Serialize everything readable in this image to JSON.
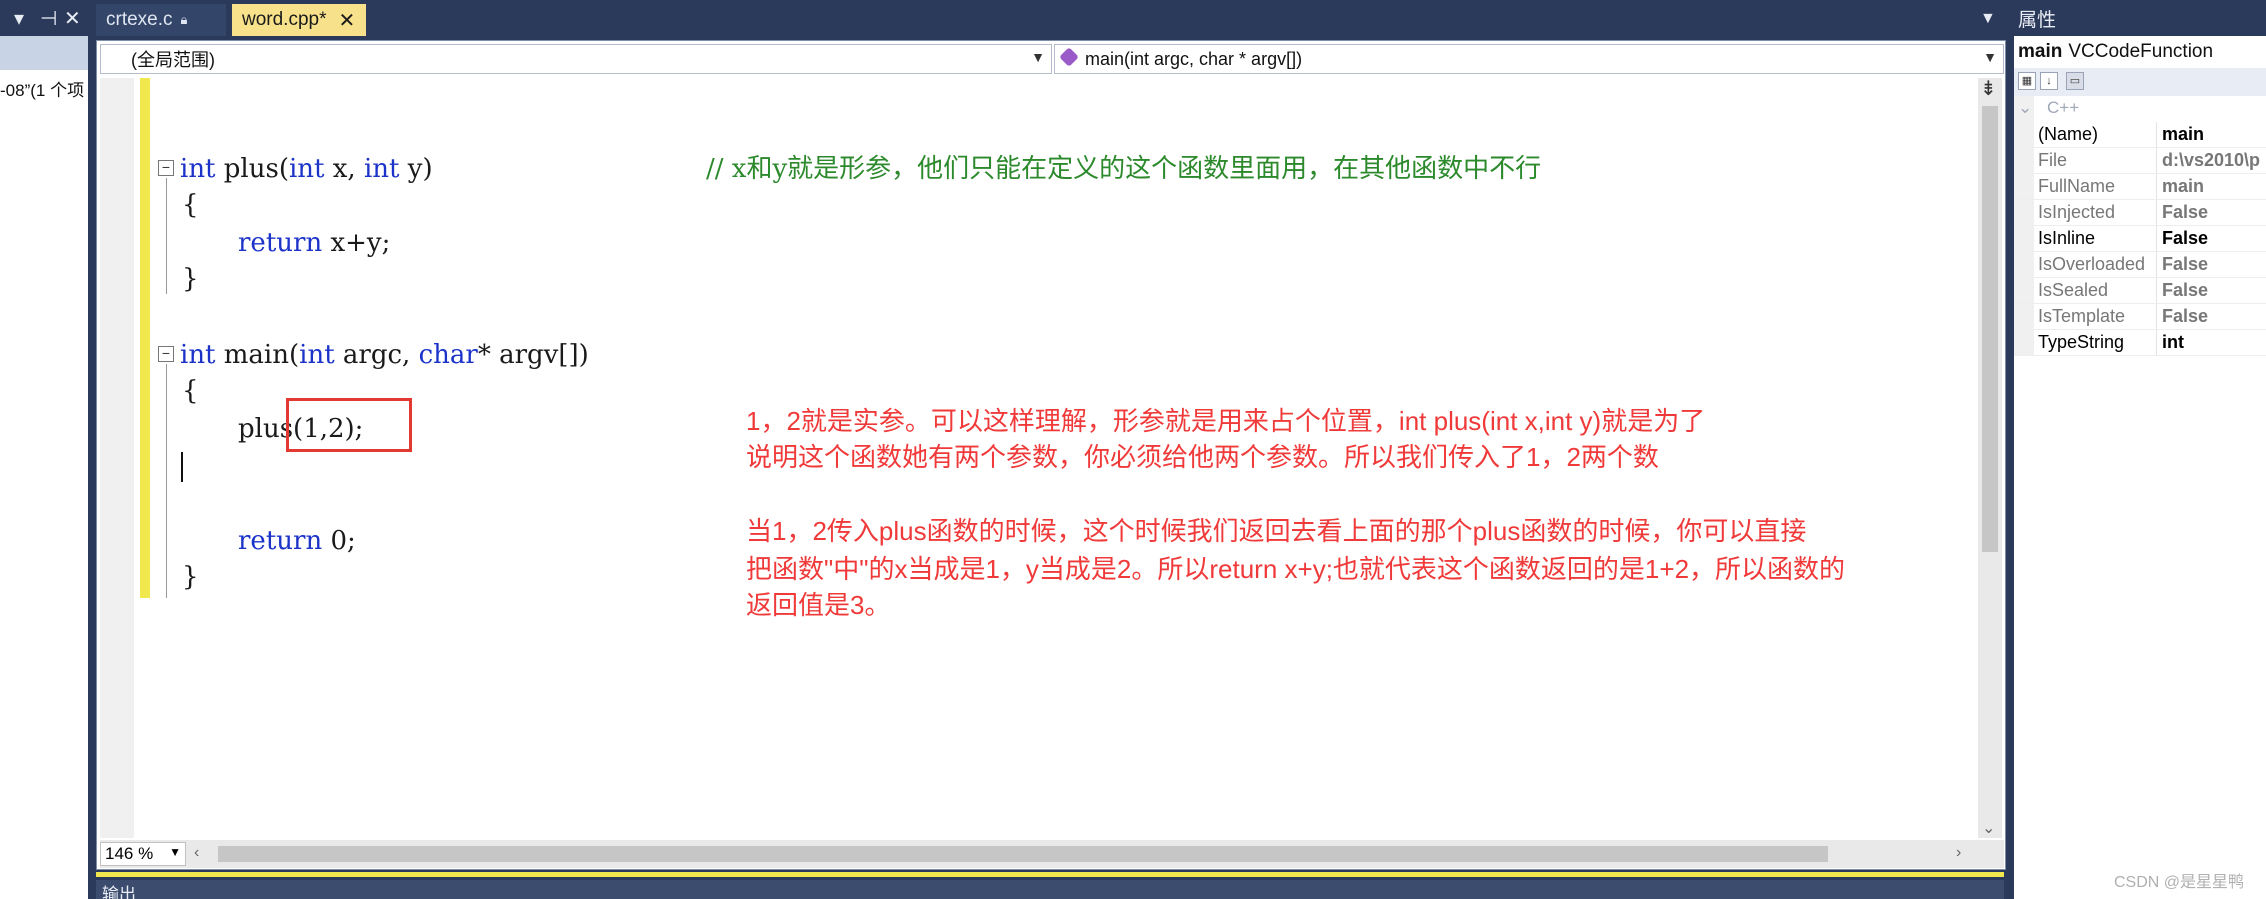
{
  "left_panel": {
    "controls": [
      "▾",
      "⊣",
      "✕"
    ],
    "truncated_text": "-08”(1 个项"
  },
  "tabs": [
    {
      "label": "crtexe.c",
      "icon": "lock-icon"
    },
    {
      "label": "word.cpp*",
      "close": "✕"
    }
  ],
  "toolbar": {
    "scope": "(全局范围)",
    "function": "main(int argc, char * argv[])"
  },
  "code": {
    "l1_kw1": "int",
    "l1_mid1": " plus(",
    "l1_kw2": "int",
    "l1_mid2": " x, ",
    "l1_kw3": "int",
    "l1_end": " y)",
    "l1_comment": "// x和y就是形参，他们只能在定义的这个函数里面用，在其他函数中不行",
    "l2": "{",
    "l3_kw": "return",
    "l3_rest": " x+y;",
    "l4": "}",
    "l5_kw1": "int",
    "l5_mid1": " main(",
    "l5_kw2": "int",
    "l5_mid2": " argc, ",
    "l5_kw3": "char",
    "l5_end": "* argv[])",
    "l6": "{",
    "l7": "plus(1,2);",
    "l8_kw": "return",
    "l8_rest": " 0;",
    "l9": "}"
  },
  "annotations": [
    "1，2就是实参。可以这样理解，形参就是用来占个位置，int plus(int x,int y)就是为了",
    "说明这个函数她有两个参数，你必须给他两个参数。所以我们传入了1，2两个数",
    "当1，2传入plus函数的时候，这个时候我们返回去看上面的那个plus函数的时候，你可以直接",
    "把函数\"中\"的x当成是1，y当成是2。所以return x+y;也就代表这个函数返回的是1+2，所以函数的",
    "返回值是3。"
  ],
  "status": {
    "zoom": "146 %"
  },
  "output_panel": {
    "title": "输出"
  },
  "properties": {
    "title": "属性",
    "object_name": "main",
    "object_type": "VCCodeFunction",
    "category": "C++",
    "rows": [
      {
        "name": "(Name)",
        "value": "main"
      },
      {
        "name": "File",
        "value": "d:\\vs2010\\p"
      },
      {
        "name": "FullName",
        "value": "main"
      },
      {
        "name": "IsInjected",
        "value": "False"
      },
      {
        "name": "IsInline",
        "value": "False"
      },
      {
        "name": "IsOverloaded",
        "value": "False"
      },
      {
        "name": "IsSealed",
        "value": "False"
      },
      {
        "name": "IsTemplate",
        "value": "False"
      },
      {
        "name": "TypeString",
        "value": "int"
      }
    ]
  },
  "watermark": "CSDN @是星星鸭",
  "colors": {
    "keyword": "#1b33c9",
    "comment": "#2c8a2c",
    "annotation": "#f03a3a",
    "active_tab": "#f7e28b",
    "ide_frame": "#2b3a5a"
  }
}
